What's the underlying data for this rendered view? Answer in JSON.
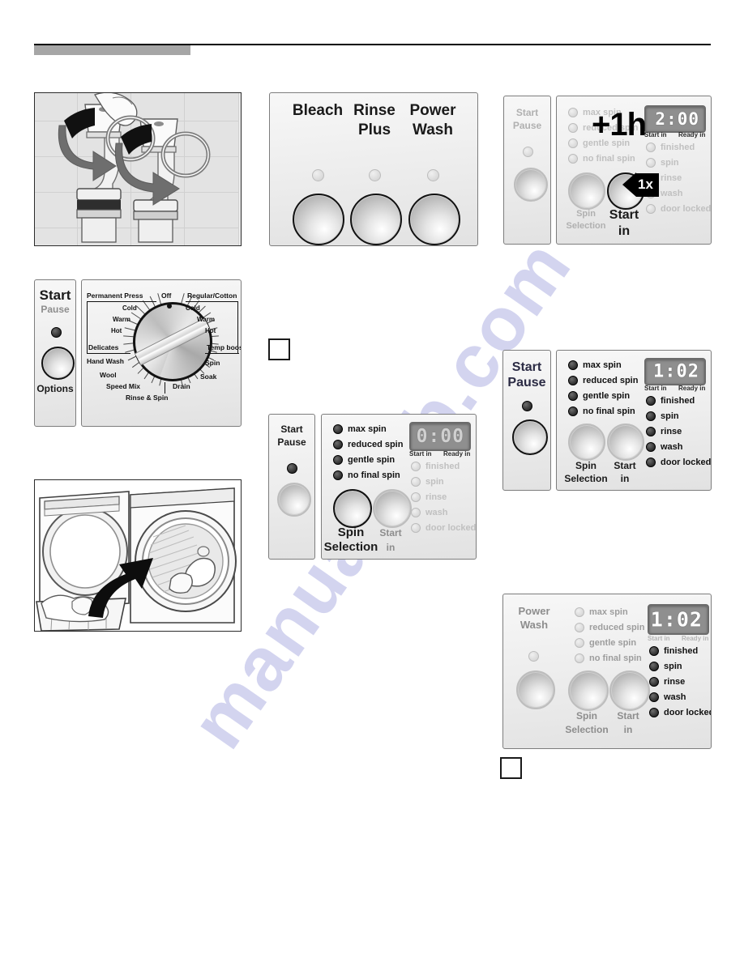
{
  "page": {
    "watermark": "manualslib.com"
  },
  "faucet_figure": {
    "name": "water-tap-open-illustration",
    "tiles_alt": "tiled wall",
    "arrows": 2
  },
  "washer_figure": {
    "name": "load-laundry-illustration",
    "arrows": 1
  },
  "options_panel": {
    "buttons": [
      {
        "label": "Bleach",
        "led": "off"
      },
      {
        "label": "Rinse\nPlus",
        "label_line1": "Rinse",
        "label_line2": "Plus",
        "led": "off"
      },
      {
        "label": "Power\nWash",
        "label_line1": "Power",
        "label_line2": "Wash",
        "led": "off"
      }
    ]
  },
  "dial_panel": {
    "start_label_line1": "Start",
    "start_label_line2": "Pause",
    "options_label": "Options",
    "center_label": "Off",
    "left_program": "Permanent Press",
    "right_program": "Regular/Cotton",
    "left_temps": [
      "Cold",
      "Warm",
      "Hot"
    ],
    "right_temps": [
      "Cold",
      "Warm",
      "Hot"
    ],
    "left_programs": [
      "Delicates",
      "Hand Wash",
      "Wool",
      "Speed Mix"
    ],
    "bottom_programs": [
      "Rinse & Spin",
      "Drain"
    ],
    "right_programs": [
      "Temp boost",
      "Spin",
      "Soak"
    ]
  },
  "panel_plus1h": {
    "start_pause_line1": "Start",
    "start_pause_line2": "Pause",
    "overlay_text": "+1h",
    "callout_text": "1x",
    "spin_selection_line1": "Spin",
    "spin_selection_line2": "Selection",
    "start_in_line1": "Start",
    "start_in_line2": "in",
    "spin_options": [
      {
        "label": "max spin",
        "state": "dim"
      },
      {
        "label": "reduced spin",
        "state": "dim"
      },
      {
        "label": "gentle spin",
        "state": "dim"
      },
      {
        "label": "no final spin",
        "state": "dim"
      }
    ],
    "display": {
      "value": "2:00",
      "start_in": "Start in",
      "ready_in": "Ready in"
    },
    "status_options": [
      {
        "label": "finished",
        "state": "dim"
      },
      {
        "label": "spin",
        "state": "dim"
      },
      {
        "label": "rinse",
        "state": "dim"
      },
      {
        "label": "wash",
        "state": "dim"
      },
      {
        "label": "door locked",
        "state": "dim"
      }
    ]
  },
  "panel_zero": {
    "start_pause_line1": "Start",
    "start_pause_line2": "Pause",
    "spin_selection_line1": "Spin",
    "spin_selection_line2": "Selection",
    "start_in_line1": "Start",
    "start_in_line2": "in",
    "spin_options": [
      {
        "label": "max spin",
        "state": "on"
      },
      {
        "label": "reduced spin",
        "state": "on"
      },
      {
        "label": "gentle spin",
        "state": "on"
      },
      {
        "label": "no final spin",
        "state": "on"
      }
    ],
    "display": {
      "value": "0:00",
      "start_in": "Start in",
      "ready_in": "Ready in"
    },
    "status_options": [
      {
        "label": "finished",
        "state": "off"
      },
      {
        "label": "spin",
        "state": "off"
      },
      {
        "label": "rinse",
        "state": "off"
      },
      {
        "label": "wash",
        "state": "off"
      },
      {
        "label": "door locked",
        "state": "off"
      }
    ]
  },
  "panel_102": {
    "start_pause_line1": "Start",
    "start_pause_line2": "Pause",
    "spin_selection_line1": "Spin",
    "spin_selection_line2": "Selection",
    "start_in_line1": "Start",
    "start_in_line2": "in",
    "spin_options": [
      {
        "label": "max spin",
        "state": "on"
      },
      {
        "label": "reduced spin",
        "state": "on"
      },
      {
        "label": "gentle spin",
        "state": "on"
      },
      {
        "label": "no final spin",
        "state": "on"
      }
    ],
    "display": {
      "value": "1:02",
      "start_in": "Start in",
      "ready_in": "Ready in"
    },
    "status_options": [
      {
        "label": "finished",
        "state": "on"
      },
      {
        "label": "spin",
        "state": "on"
      },
      {
        "label": "rinse",
        "state": "on"
      },
      {
        "label": "wash",
        "state": "on"
      },
      {
        "label": "door locked",
        "state": "on"
      }
    ]
  },
  "panel_powerwash": {
    "power_wash_line1": "Power",
    "power_wash_line2": "Wash",
    "spin_selection_line1": "Spin",
    "spin_selection_line2": "Selection",
    "start_in_line1": "Start",
    "start_in_line2": "in",
    "spin_options": [
      {
        "label": "max spin",
        "state": "off"
      },
      {
        "label": "reduced spin",
        "state": "off"
      },
      {
        "label": "gentle spin",
        "state": "off"
      },
      {
        "label": "no final spin",
        "state": "off"
      }
    ],
    "display": {
      "value": "1:02",
      "start_in": "Start in",
      "ready_in": "Ready in"
    },
    "status_options": [
      {
        "label": "finished",
        "state": "on"
      },
      {
        "label": "spin",
        "state": "on"
      },
      {
        "label": "rinse",
        "state": "on"
      },
      {
        "label": "wash",
        "state": "on"
      },
      {
        "label": "door locked",
        "state": "on"
      }
    ]
  },
  "step_boxes": [
    {
      "name": "step-box-left",
      "value": ""
    },
    {
      "name": "step-box-bottom",
      "value": ""
    }
  ]
}
